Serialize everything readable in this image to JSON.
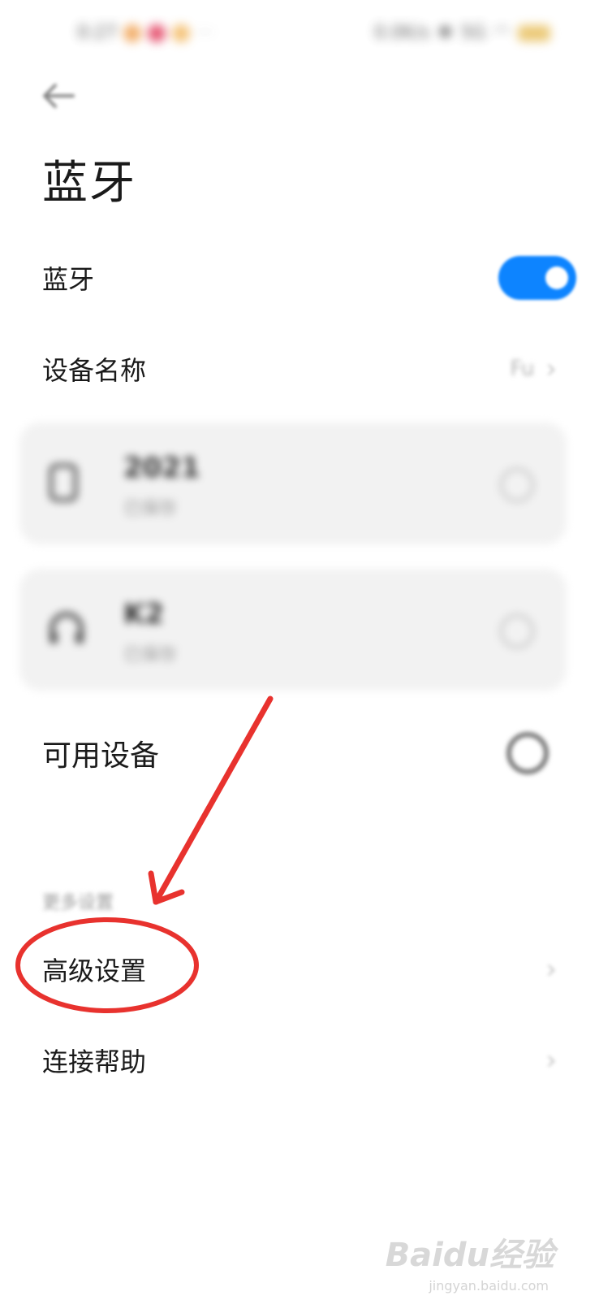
{
  "status_bar": {
    "time": "0:27",
    "speed": "0.0K/s",
    "signal": "5G"
  },
  "header": {
    "title": "蓝牙"
  },
  "bluetooth_row": {
    "label": "蓝牙",
    "enabled": true,
    "accent": "#0d84ff"
  },
  "device_name_row": {
    "label": "设备名称",
    "value": "Fu"
  },
  "paired_devices": [
    {
      "name": "2021",
      "status": "已保存",
      "icon": "phone-icon"
    },
    {
      "name": "K2",
      "status": "已保存",
      "icon": "headphones-icon"
    }
  ],
  "available_row": {
    "label": "可用设备"
  },
  "section": {
    "title": "更多设置"
  },
  "advanced_row": {
    "label": "高级设置"
  },
  "help_row": {
    "label": "连接帮助"
  },
  "annotation": {
    "color": "#e8322e"
  },
  "watermark": {
    "brand": "Baidu经验",
    "sub": "jingyan.baidu.com"
  }
}
